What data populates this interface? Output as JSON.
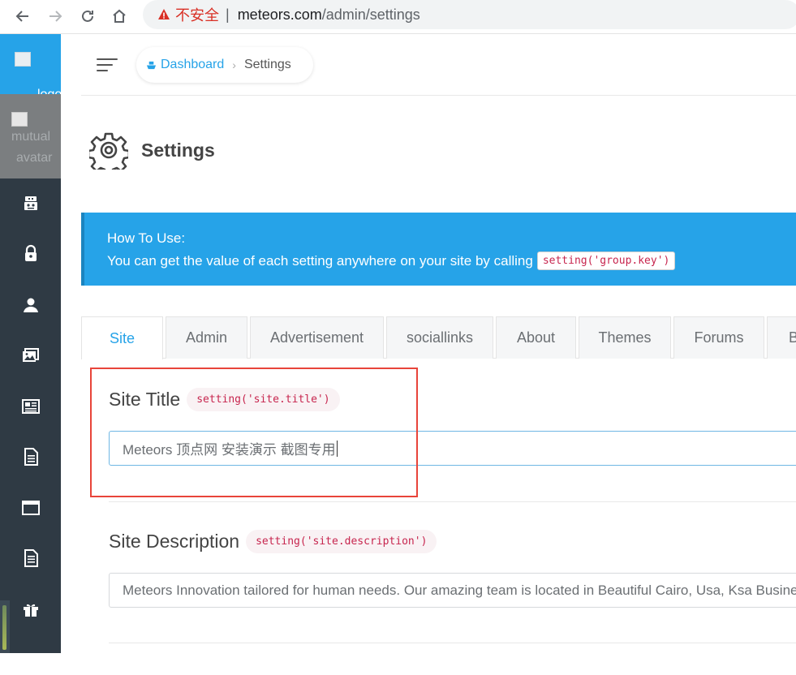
{
  "browser": {
    "security_label": "不安全",
    "separator": "|",
    "url_host": "meteors.com",
    "url_path": "/admin/settings"
  },
  "sidebar": {
    "logo_alt": "logo",
    "avatar_alt_line1": "mutual",
    "avatar_alt_line2": "avatar",
    "items": [
      {
        "icon": "robot-icon"
      },
      {
        "icon": "lock-icon"
      },
      {
        "icon": "user-icon"
      },
      {
        "icon": "images-icon"
      },
      {
        "icon": "news-icon"
      },
      {
        "icon": "document-icon"
      },
      {
        "icon": "browser-window-icon"
      },
      {
        "icon": "file-text-icon"
      },
      {
        "icon": "gift-icon"
      }
    ]
  },
  "header": {
    "breadcrumb": {
      "home_label": "Dashboard",
      "current_label": "Settings"
    }
  },
  "page": {
    "title": "Settings"
  },
  "info": {
    "title": "How To Use:",
    "text": "You can get the value of each setting anywhere on your site by calling",
    "code": "setting('group.key')"
  },
  "tabs": [
    {
      "label": "Site",
      "active": true
    },
    {
      "label": "Admin",
      "active": false
    },
    {
      "label": "Advertisement",
      "active": false
    },
    {
      "label": "sociallinks",
      "active": false
    },
    {
      "label": "About",
      "active": false
    },
    {
      "label": "Themes",
      "active": false
    },
    {
      "label": "Forums",
      "active": false
    },
    {
      "label": "B",
      "active": false
    }
  ],
  "fields": {
    "site_title": {
      "label": "Site Title",
      "code": "setting('site.title')",
      "value": "Meteors 顶点网 安装演示 截图专用"
    },
    "site_description": {
      "label": "Site Description",
      "code": "setting('site.description')",
      "value": "Meteors Innovation tailored for human needs. Our amazing team is located in Beautiful Cairo, Usa, Ksa Business"
    }
  },
  "colors": {
    "accent": "#26a3e8",
    "sidebar": "#2f3a44",
    "code_text": "#c7254e",
    "highlight": "#e8443a"
  }
}
